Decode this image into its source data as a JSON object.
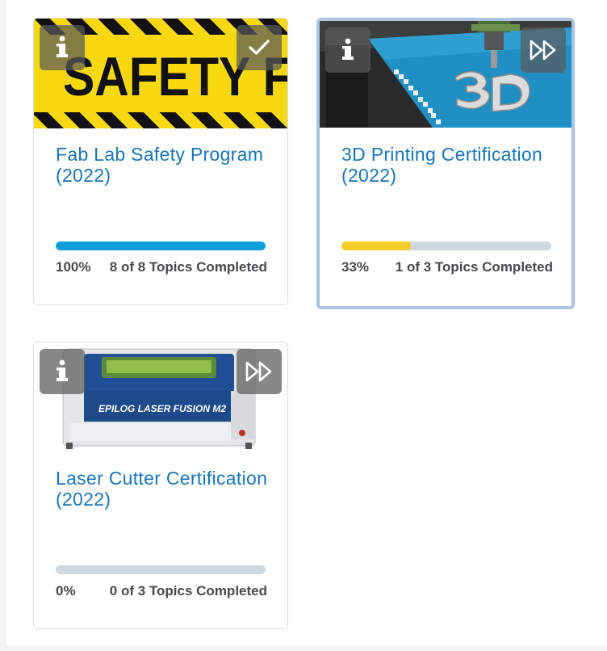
{
  "cards": [
    {
      "title": "Fab Lab Safety Program (2022)",
      "percent_text": "100%",
      "topics_text": "8 of 8 Topics Completed",
      "progress": 1.0,
      "bar_color": "#0e9fd8",
      "thumb_text": "SAFETY FI",
      "left_icon": "info-icon",
      "right_icon": "check-icon",
      "focused": false
    },
    {
      "title": "3D Printing Certification (2022)",
      "percent_text": "33%",
      "topics_text": "1 of 3 Topics Completed",
      "progress": 0.33,
      "bar_color": "#f6c926",
      "left_icon": "info-icon",
      "right_icon": "fast-forward-icon",
      "focused": true
    },
    {
      "title": "Laser Cutter Certification (2022)",
      "percent_text": "0%",
      "topics_text": "0 of 3 Topics Completed",
      "progress": 0.0,
      "bar_color": "#0e9fd8",
      "thumb_text": "EPILOG LASER FUSION M2",
      "left_icon": "info-icon",
      "right_icon": "fast-forward-icon",
      "focused": false
    }
  ],
  "colors": {
    "title": "#1a74b5",
    "track": "#ced6de",
    "focus_border": "#a9c4e4"
  }
}
